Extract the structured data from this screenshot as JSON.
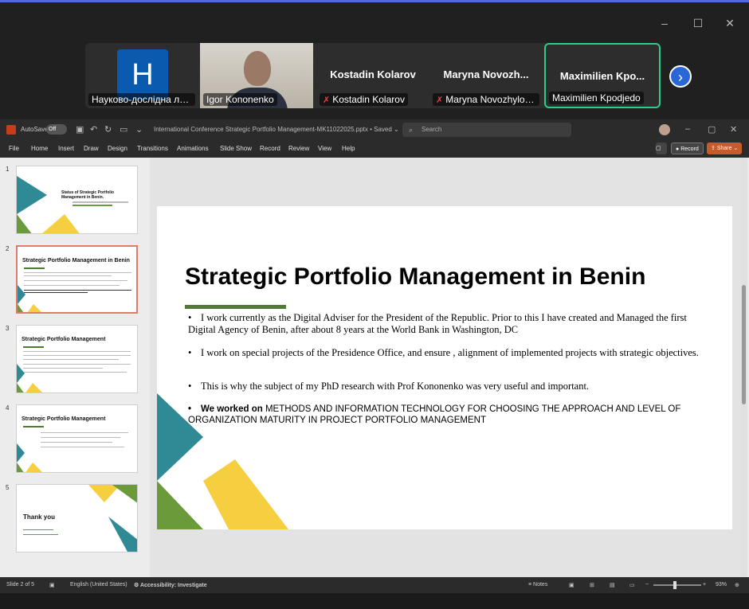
{
  "meeting": {
    "participants": [
      {
        "display": "H",
        "name": "Науково-дослідна лабо..."
      },
      {
        "display": "",
        "name": "Igor Kononenko"
      },
      {
        "display": "Kostadin Kolarov",
        "name": "Kostadin Kolarov",
        "muted": true
      },
      {
        "display": "Maryna  Novozh...",
        "name": "Maryna Novozhylova,...",
        "muted": true
      },
      {
        "display": "Maximilien  Kpo...",
        "name": "Maximilien Kpodjedo",
        "active": true
      }
    ],
    "next_icon": "chevron-right-icon",
    "window_controls": [
      "–",
      "☐",
      "✕"
    ]
  },
  "ppt": {
    "autosave_label": "AutoSave",
    "autosave_state": "Off",
    "doc_title": "International Conference Strategic Portfolio Management-MK11022025.pptx • Saved ⌄",
    "search_placeholder": "Search",
    "menu": [
      "File",
      "Home",
      "Insert",
      "Draw",
      "Design",
      "Transitions",
      "Animations",
      "Slide Show",
      "Record",
      "Review",
      "View",
      "Help"
    ],
    "record_btn": "Record",
    "share_btn": "Share",
    "thumbs": [
      {
        "num": "1",
        "title": "Status of Strategic Portfolio Management in Benin."
      },
      {
        "num": "2",
        "title": "Strategic Portfolio Management in Benin"
      },
      {
        "num": "3",
        "title": "Strategic Portfolio Management"
      },
      {
        "num": "4",
        "title": "Strategic Portfolio Management"
      },
      {
        "num": "5",
        "title": "Thank you"
      }
    ],
    "slide": {
      "title": "Strategic Portfolio Management in Benin",
      "bullets": [
        "I work currently as the Digital Adviser for the President of the Republic. Prior to this I have created and Managed the first Digital Agency of Benin, after about 8 years at the World Bank in Washington, DC",
        "I work on special projects of the Presidence Office, and ensure , alignment of implemented projects with strategic objectives.",
        "This is why the subject of my PhD research with Prof Kononenko was very useful and important."
      ],
      "last_bullet_prefix": "We worked on",
      "last_bullet_rest": "METHODS AND INFORMATION TECHNOLOGY FOR CHOOSING THE APPROACH AND LEVEL OF ORGANIZATION MATURITY IN PROJECT PORTFOLIO MANAGEMENT"
    },
    "status": {
      "slide_info": "Slide 2 of 5",
      "language": "English (United States)",
      "accessibility": "Accessibility: Investigate",
      "notes": "Notes",
      "zoom": "93%"
    },
    "colors": {
      "teal": "#2f8a96",
      "yellow": "#f5cf3f",
      "green": "#6b9a3a"
    }
  }
}
